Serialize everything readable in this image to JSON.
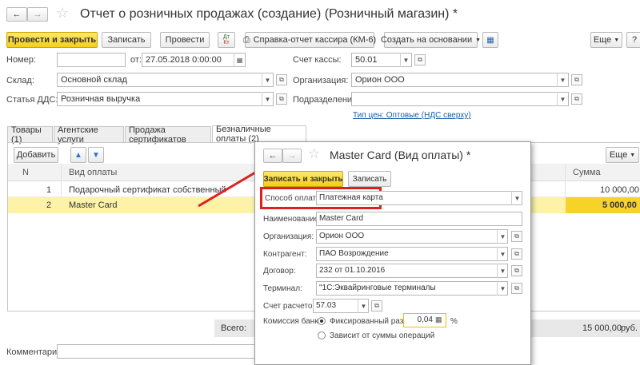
{
  "window": {
    "title": "Отчет о розничных продажах (создание) (Розничный магазин) *"
  },
  "toolbar": {
    "post_close": "Провести и закрыть",
    "save": "Записать",
    "post": "Провести",
    "dt_kt": "Дт\nКт",
    "cashier_report": "Справка-отчет кассира (КМ-6)",
    "create_based": "Создать на основании",
    "more": "Еще",
    "help": "?"
  },
  "header": {
    "number_label": "Номер:",
    "number_value": "",
    "from_label": "от:",
    "date_value": "27.05.2018  0:00:00",
    "cash_account_label": "Счет кассы:",
    "cash_account_value": "50.01",
    "warehouse_label": "Склад:",
    "warehouse_value": "Основной склад",
    "org_label": "Организация:",
    "org_value": "Орион ООО",
    "dds_label": "Статья ДДС:",
    "dds_value": "Розничная выручка",
    "division_label": "Подразделение:",
    "division_value": "",
    "price_type_link": "Тип цен: Оптовые (НДС сверху)"
  },
  "tabs": [
    {
      "label": "Товары (1)"
    },
    {
      "label": "Агентские услуги"
    },
    {
      "label": "Продажа сертификатов"
    },
    {
      "label": "Безналичные оплаты (2)"
    }
  ],
  "table": {
    "add_button": "Добавить",
    "more": "Еще",
    "columns": {
      "n": "N",
      "payment_type": "Вид оплаты",
      "sum": "Сумма"
    },
    "rows": [
      {
        "n": "1",
        "payment_type": "Подарочный сертификат собственный",
        "sum": "10 000,00"
      },
      {
        "n": "2",
        "payment_type": "Master Card",
        "sum": "5 000,00"
      }
    ],
    "total_label": "Всего:",
    "total_value": "15 000,00",
    "currency": "руб."
  },
  "footer": {
    "comment_label": "Комментарий:",
    "comment_value": ""
  },
  "dialog": {
    "title": "Master Card (Вид оплаты) *",
    "save_close": "Записать и закрыть",
    "save": "Записать",
    "pay_method_label": "Способ оплаты:",
    "pay_method_value": "Платежная карта",
    "name_label": "Наименование:",
    "name_value": "Master Card",
    "org_label": "Организация:",
    "org_value": "Орион ООО",
    "contractor_label": "Контрагент:",
    "contractor_value": "ПАО Возрождение",
    "contract_label": "Договор:",
    "contract_value": "232 от 01.10.2016",
    "terminal_label": "Терминал:",
    "terminal_value": "\"1С:Эквайринговые терминалы",
    "settle_account_label": "Счет расчетов:",
    "settle_account_value": "57.03",
    "commission_label": "Комиссия банка:",
    "fixed_size_label": "Фиксированный размер",
    "commission_value": "0,04",
    "percent": "%",
    "depends_label": "Зависит от суммы операций"
  },
  "colors": {
    "accent_yellow": "#f5d327",
    "highlight_row": "#fdf2a8",
    "red": "#e02020"
  }
}
